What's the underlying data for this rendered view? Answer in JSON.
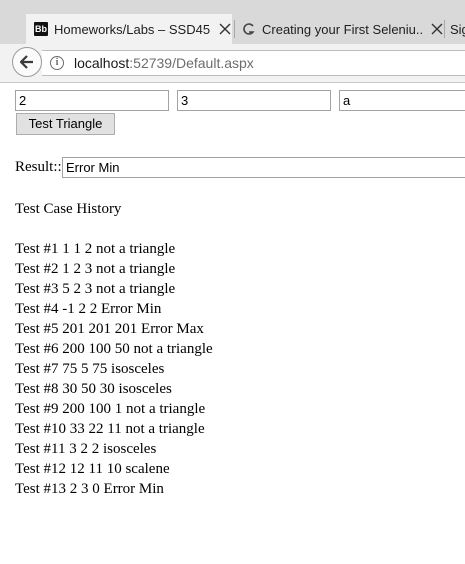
{
  "browser": {
    "tabs": [
      {
        "title": "Homeworks/Labs – SSD45...",
        "icon": "blackboard-icon",
        "icon_text": "Bb",
        "active": true
      },
      {
        "title": "Creating your First Seleniu...",
        "icon": "selenium-icon",
        "active": false
      },
      {
        "title": "Sig",
        "icon": "",
        "active": false
      }
    ],
    "address": {
      "host": "localhost",
      "path": ":52739/Default.aspx"
    }
  },
  "form": {
    "side_a": "2",
    "side_b": "3",
    "side_c": "a",
    "test_button_label": "Test Triangle",
    "result_label": "Result::",
    "result_value": "Error Min"
  },
  "history": {
    "title": "Test Case History",
    "entries": [
      "Test #1 1 1 2 not a triangle",
      "Test #2 1 2 3 not a triangle",
      "Test #3 5 2 3 not a triangle",
      "Test #4 -1 2 2 Error Min",
      "Test #5 201 201 201 Error Max",
      "Test #6 200 100 50 not a triangle",
      "Test #7 75 5 75 isosceles",
      "Test #8 30 50 30 isosceles",
      "Test #9 200 100 1 not a triangle",
      "Test #10 33 22 11 not a triangle",
      "Test #11 3 2 2 isosceles",
      "Test #12 12 11 10 scalene",
      "Test #13 2 3 0 Error Min"
    ]
  }
}
